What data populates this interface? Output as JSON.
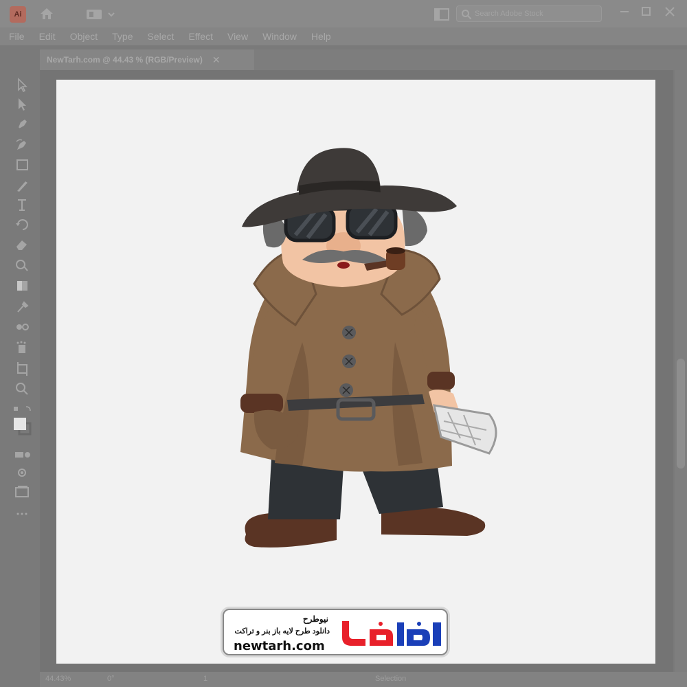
{
  "app": {
    "logo_text": "Ai",
    "search_placeholder": "Search Adobe Stock",
    "accent": "#b36b5e"
  },
  "menu": [
    "File",
    "Edit",
    "Object",
    "Type",
    "Select",
    "Effect",
    "View",
    "Window",
    "Help"
  ],
  "document_tab": {
    "label": "NewTarh.com @ 44.43 % (RGB/Preview)",
    "close": "✕"
  },
  "tools": [
    "selection-tool",
    "direct-selection-tool",
    "pen-tool",
    "curvature-tool",
    "rectangle-tool",
    "paintbrush-tool",
    "type-tool",
    "rotate-tool",
    "eraser-tool",
    "shape-builder-tool",
    "gradient-tool",
    "eyedropper-tool",
    "blend-tool",
    "symbol-sprayer-tool",
    "artboard-tool",
    "zoom-tool",
    "fill-stroke-swatches",
    "draw-mode",
    "screen-mode",
    "edit-toolbar"
  ],
  "statusbar": {
    "zoom": "44.43%",
    "rotation": "0°",
    "artboard": "1",
    "mode": "Selection"
  },
  "watermark": {
    "title": "نیوطرح",
    "subtitle": "دانلود طرح لایه باز بنر و تراکت",
    "url": "newtarh.com",
    "logo_text": "نیوطرح",
    "logo_colors": [
      "#e8202a",
      "#1a3fb8"
    ]
  },
  "illustration": {
    "subject": "cartoon-detective",
    "colors": {
      "coat": "#8b6a4b",
      "coat_shadow": "#6e523a",
      "hat": "#3e3a38",
      "pants": "#2e3236",
      "shoes": "#5a3424",
      "skin": "#f2c4a4",
      "hair": "#6a6a6a",
      "newspaper": "#e6e6e6"
    }
  }
}
